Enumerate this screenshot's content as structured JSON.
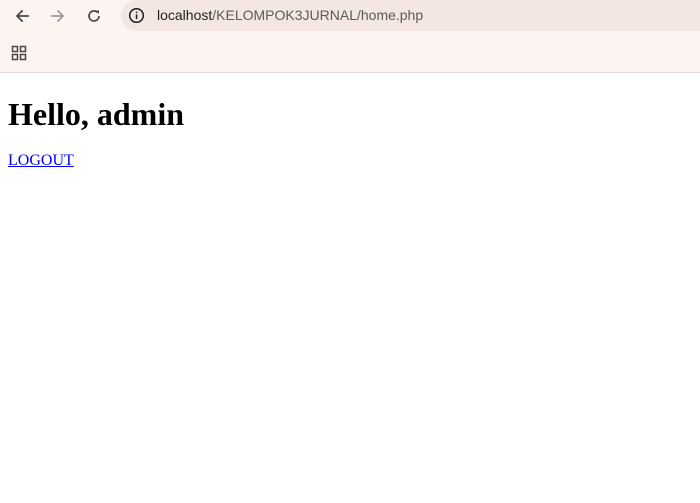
{
  "browser": {
    "url_host": "localhost",
    "url_path": "/KELOMPOK3JURNAL/home.php",
    "icons": {
      "back": "back-arrow-icon",
      "forward": "forward-arrow-icon",
      "reload": "reload-icon",
      "site_info": "info-icon",
      "apps": "apps-grid-icon"
    }
  },
  "page": {
    "heading": "Hello, admin",
    "logout_label": "LOGOUT"
  },
  "colors": {
    "chrome_bg": "#fdf3f1",
    "omnibox_bg": "#f4e6e3",
    "link": "#0000ee"
  }
}
